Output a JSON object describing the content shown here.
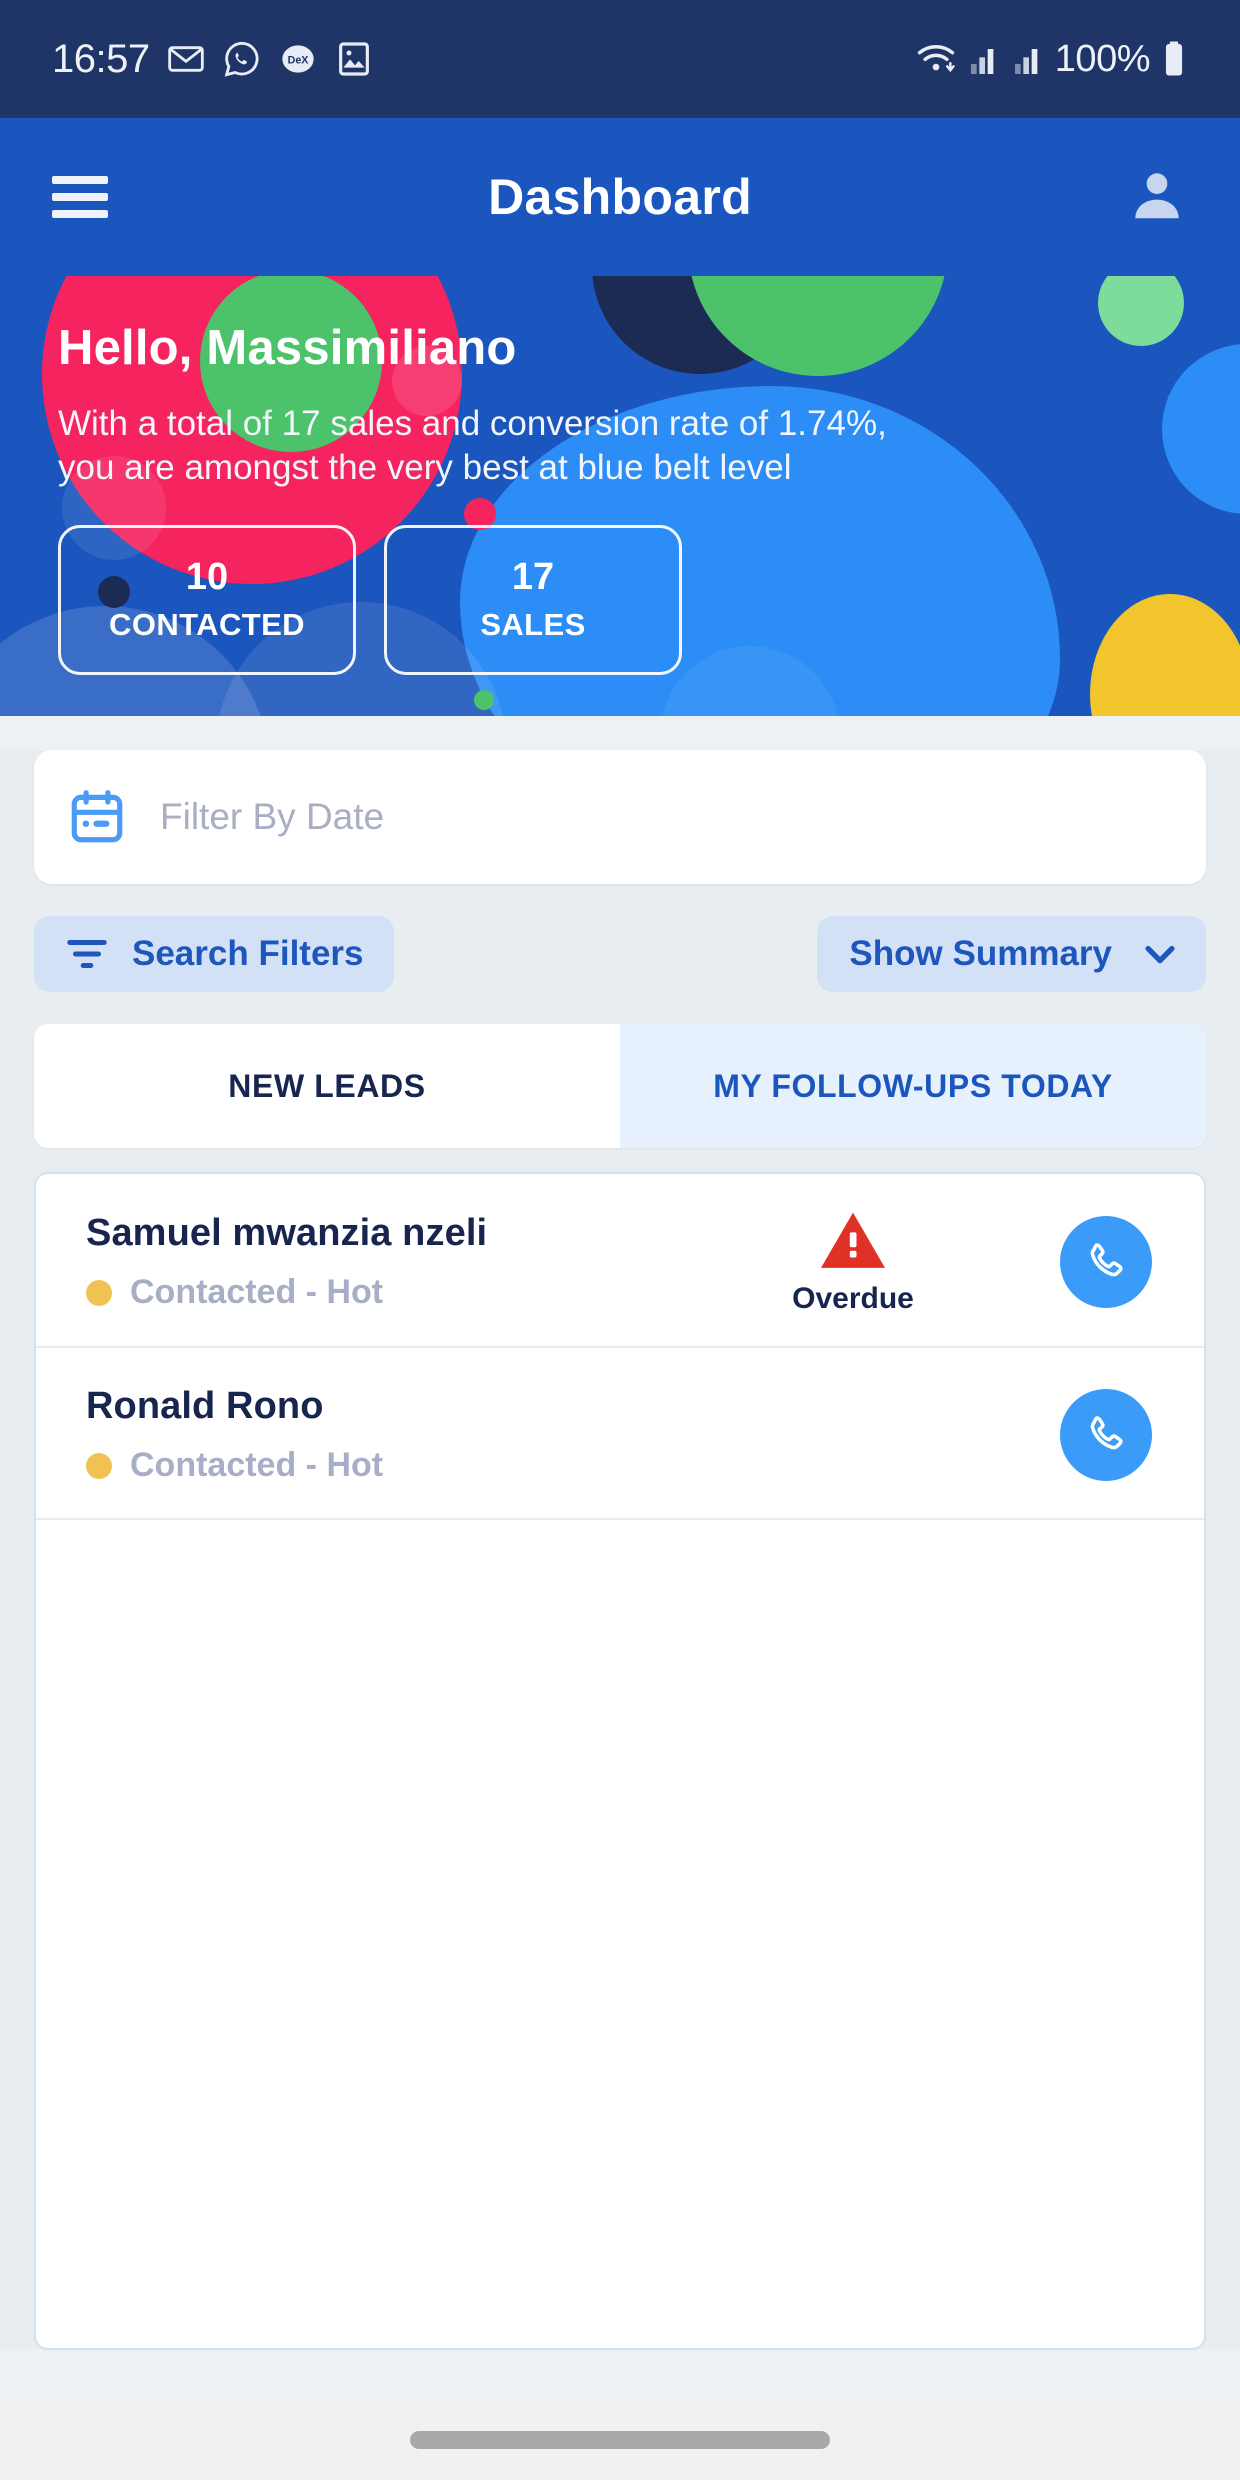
{
  "statusbar": {
    "time": "16:57",
    "battery_percent": "100%",
    "icons": [
      "gmail-icon",
      "whatsapp-icon",
      "dex-icon",
      "gallery-icon",
      "wifi-icon",
      "signal-icon-1",
      "signal-icon-2",
      "battery-icon"
    ]
  },
  "appbar": {
    "title": "Dashboard",
    "menu_icon": "hamburger-icon",
    "profile_icon": "person-icon"
  },
  "hero": {
    "greeting": "Hello, Massimiliano",
    "summary": "With a total of 17 sales and conversion rate of 1.74%, you are amongst the very best at blue belt level",
    "stats": [
      {
        "value": "10",
        "label": "CONTACTED"
      },
      {
        "value": "17",
        "label": "SALES"
      }
    ],
    "colors": {
      "background": "#1a56bd",
      "pink": "#f5245f",
      "green": "#4cc36a",
      "light_green": "#7ddb9b",
      "bright_blue": "#2b8df5",
      "navy": "#1b2b53",
      "yellow": "#f2c52d"
    }
  },
  "filters": {
    "date_placeholder": "Filter By Date",
    "date_value": "",
    "calendar_icon": "calendar-icon",
    "search_filters_label": "Search Filters",
    "filter_icon": "filter-icon",
    "show_summary_label": "Show Summary",
    "chevron_icon": "chevron-down-icon"
  },
  "tabs": [
    {
      "label": "NEW LEADS",
      "active": false
    },
    {
      "label": "MY FOLLOW-UPS TODAY",
      "active": true
    }
  ],
  "leads": [
    {
      "name": "Samuel mwanzia nzeli",
      "status": "Contacted - Hot",
      "status_dot_color": "#f0c254",
      "badge": "Overdue",
      "badge_icon": "warning-triangle-icon",
      "action_icon": "phone-icon"
    },
    {
      "name": "Ronald Rono",
      "status": "Contacted - Hot",
      "status_dot_color": "#f0c254",
      "badge": "",
      "badge_icon": "",
      "action_icon": "phone-icon"
    }
  ],
  "navbar": {
    "home_indicator": "home-indicator"
  }
}
